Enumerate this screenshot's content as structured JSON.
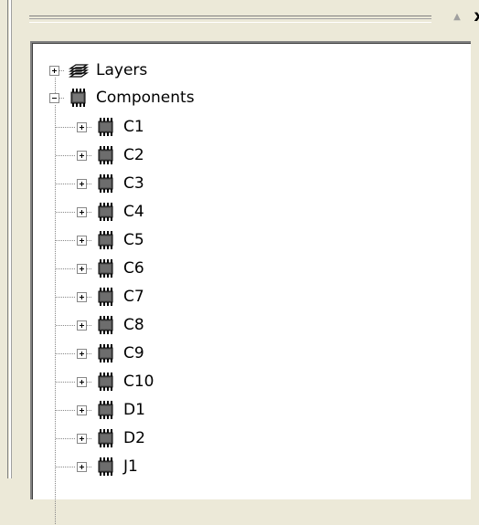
{
  "panel": {
    "pin_icon": "pin-icon",
    "close_glyph": "x"
  },
  "tree": {
    "layers_label": "Layers",
    "components_label": "Components",
    "components": [
      "C1",
      "C2",
      "C3",
      "C4",
      "C5",
      "C6",
      "C7",
      "C8",
      "C9",
      "C10",
      "D1",
      "D2",
      "J1"
    ]
  }
}
